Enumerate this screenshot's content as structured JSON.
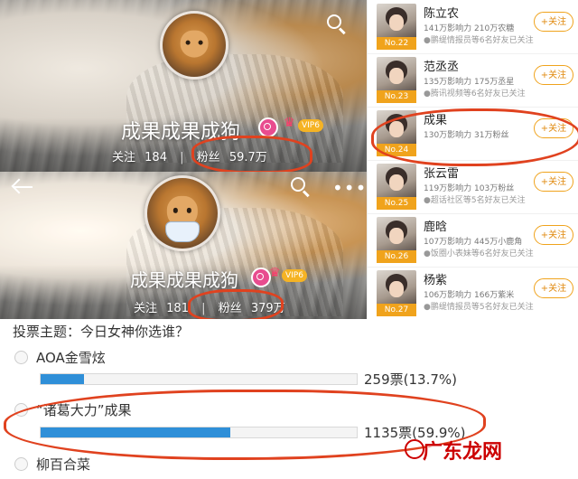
{
  "profile_top": {
    "name": "成果成果成狗",
    "vip": "VIP6",
    "follow_label": "关注",
    "follow_count": "184",
    "fans_label": "粉丝",
    "fans_count": "59.7万"
  },
  "profile_bottom": {
    "name": "成果成果成狗",
    "vip": "VIP6",
    "follow_label": "关注",
    "follow_count": "181",
    "fans_label": "粉丝",
    "fans_count": "379万"
  },
  "ranking": [
    {
      "name": "陈立农",
      "rank": "No.22",
      "line1": "141万影响力 210万农糖",
      "line2": "●鹏缇情报员等6名好友已关注",
      "follow": "+关注"
    },
    {
      "name": "范丞丞",
      "rank": "No.23",
      "line1": "135万影响力 175万丞星",
      "line2": "●腾讯视频等6名好友已关注",
      "follow": "+关注"
    },
    {
      "name": "成果",
      "rank": "No.24",
      "line1": "130万影响力 31万粉丝",
      "line2": "",
      "follow": "+关注"
    },
    {
      "name": "张云雷",
      "rank": "No.25",
      "line1": "119万影响力 103万粉丝",
      "line2": "●超话社区等5名好友已关注",
      "follow": "+关注"
    },
    {
      "name": "鹿晗",
      "rank": "No.26",
      "line1": "107万影响力 445万小鹿角",
      "line2": "●饭圈小表妹等6名好友已关注",
      "follow": "+关注"
    },
    {
      "name": "杨紫",
      "rank": "No.27",
      "line1": "106万影响力 166万紫米",
      "line2": "●鹏缇情报员等5名好友已关注",
      "follow": "+关注"
    }
  ],
  "vote": {
    "title": "投票主题：今日女神你选谁？",
    "options": [
      {
        "label": "AOA金雪炫",
        "result": "259票(13.7%)",
        "percent": 13.7
      },
      {
        "label": "“诸葛大力”成果",
        "result": "1135票(59.9%)",
        "percent": 59.9
      },
      {
        "label": "柳百合菜",
        "result": "",
        "percent": 0
      }
    ]
  },
  "watermark": "广东龙网"
}
